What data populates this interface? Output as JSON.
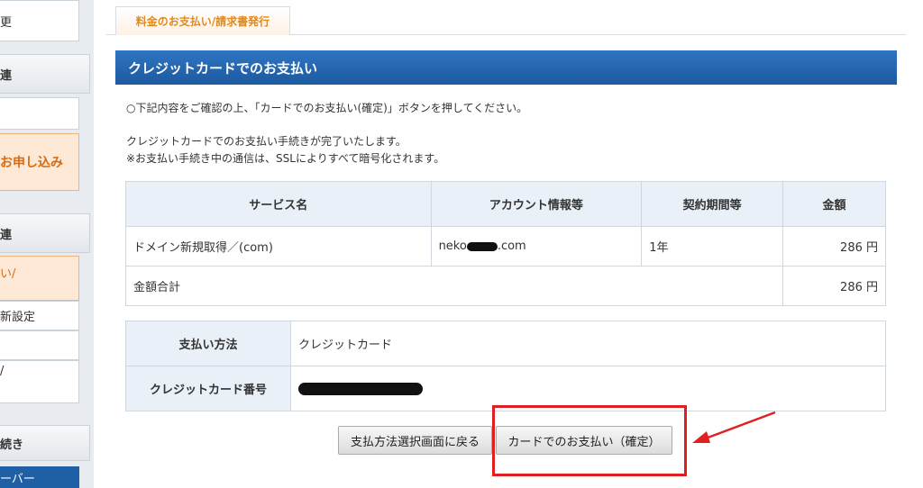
{
  "sidebar": {
    "item_top": "更",
    "head1": "連",
    "apply_button": "お申し込み",
    "head2": "連",
    "active_item": "い/",
    "item_settings": "新設定",
    "item_slash": "/",
    "head3": "続き",
    "server_item": "ーバー"
  },
  "tab": {
    "label": "料金のお支払い/請求書発行"
  },
  "section": {
    "title": "クレジットカードでのお支払い"
  },
  "instructions": {
    "line1": "○下記内容をご確認の上、「カードでのお支払い(確定)」ボタンを押してください。",
    "line2": "クレジットカードでのお支払い手続きが完了いたします。",
    "line3": "※お支払い手続き中の通信は、SSLによりすべて暗号化されます。"
  },
  "service_table": {
    "headers": [
      "サービス名",
      "アカウント情報等",
      "契約期間等",
      "金額"
    ],
    "row": {
      "service": "ドメイン新規取得／(com)",
      "account_prefix": "neko",
      "account_suffix": ".com",
      "period": "1年",
      "amount": "286 円"
    },
    "total_label": "金額合計",
    "total_amount": "286 円"
  },
  "payment_table": {
    "method_label": "支払い方法",
    "method_value": "クレジットカード",
    "card_label": "クレジットカード番号"
  },
  "buttons": {
    "back": "支払方法選択画面に戻る",
    "confirm": "カードでのお支払い（確定）"
  },
  "colors": {
    "accent_blue": "#1d5aa0",
    "tab_orange": "#e08a1e",
    "annotation_red": "#e02020"
  }
}
